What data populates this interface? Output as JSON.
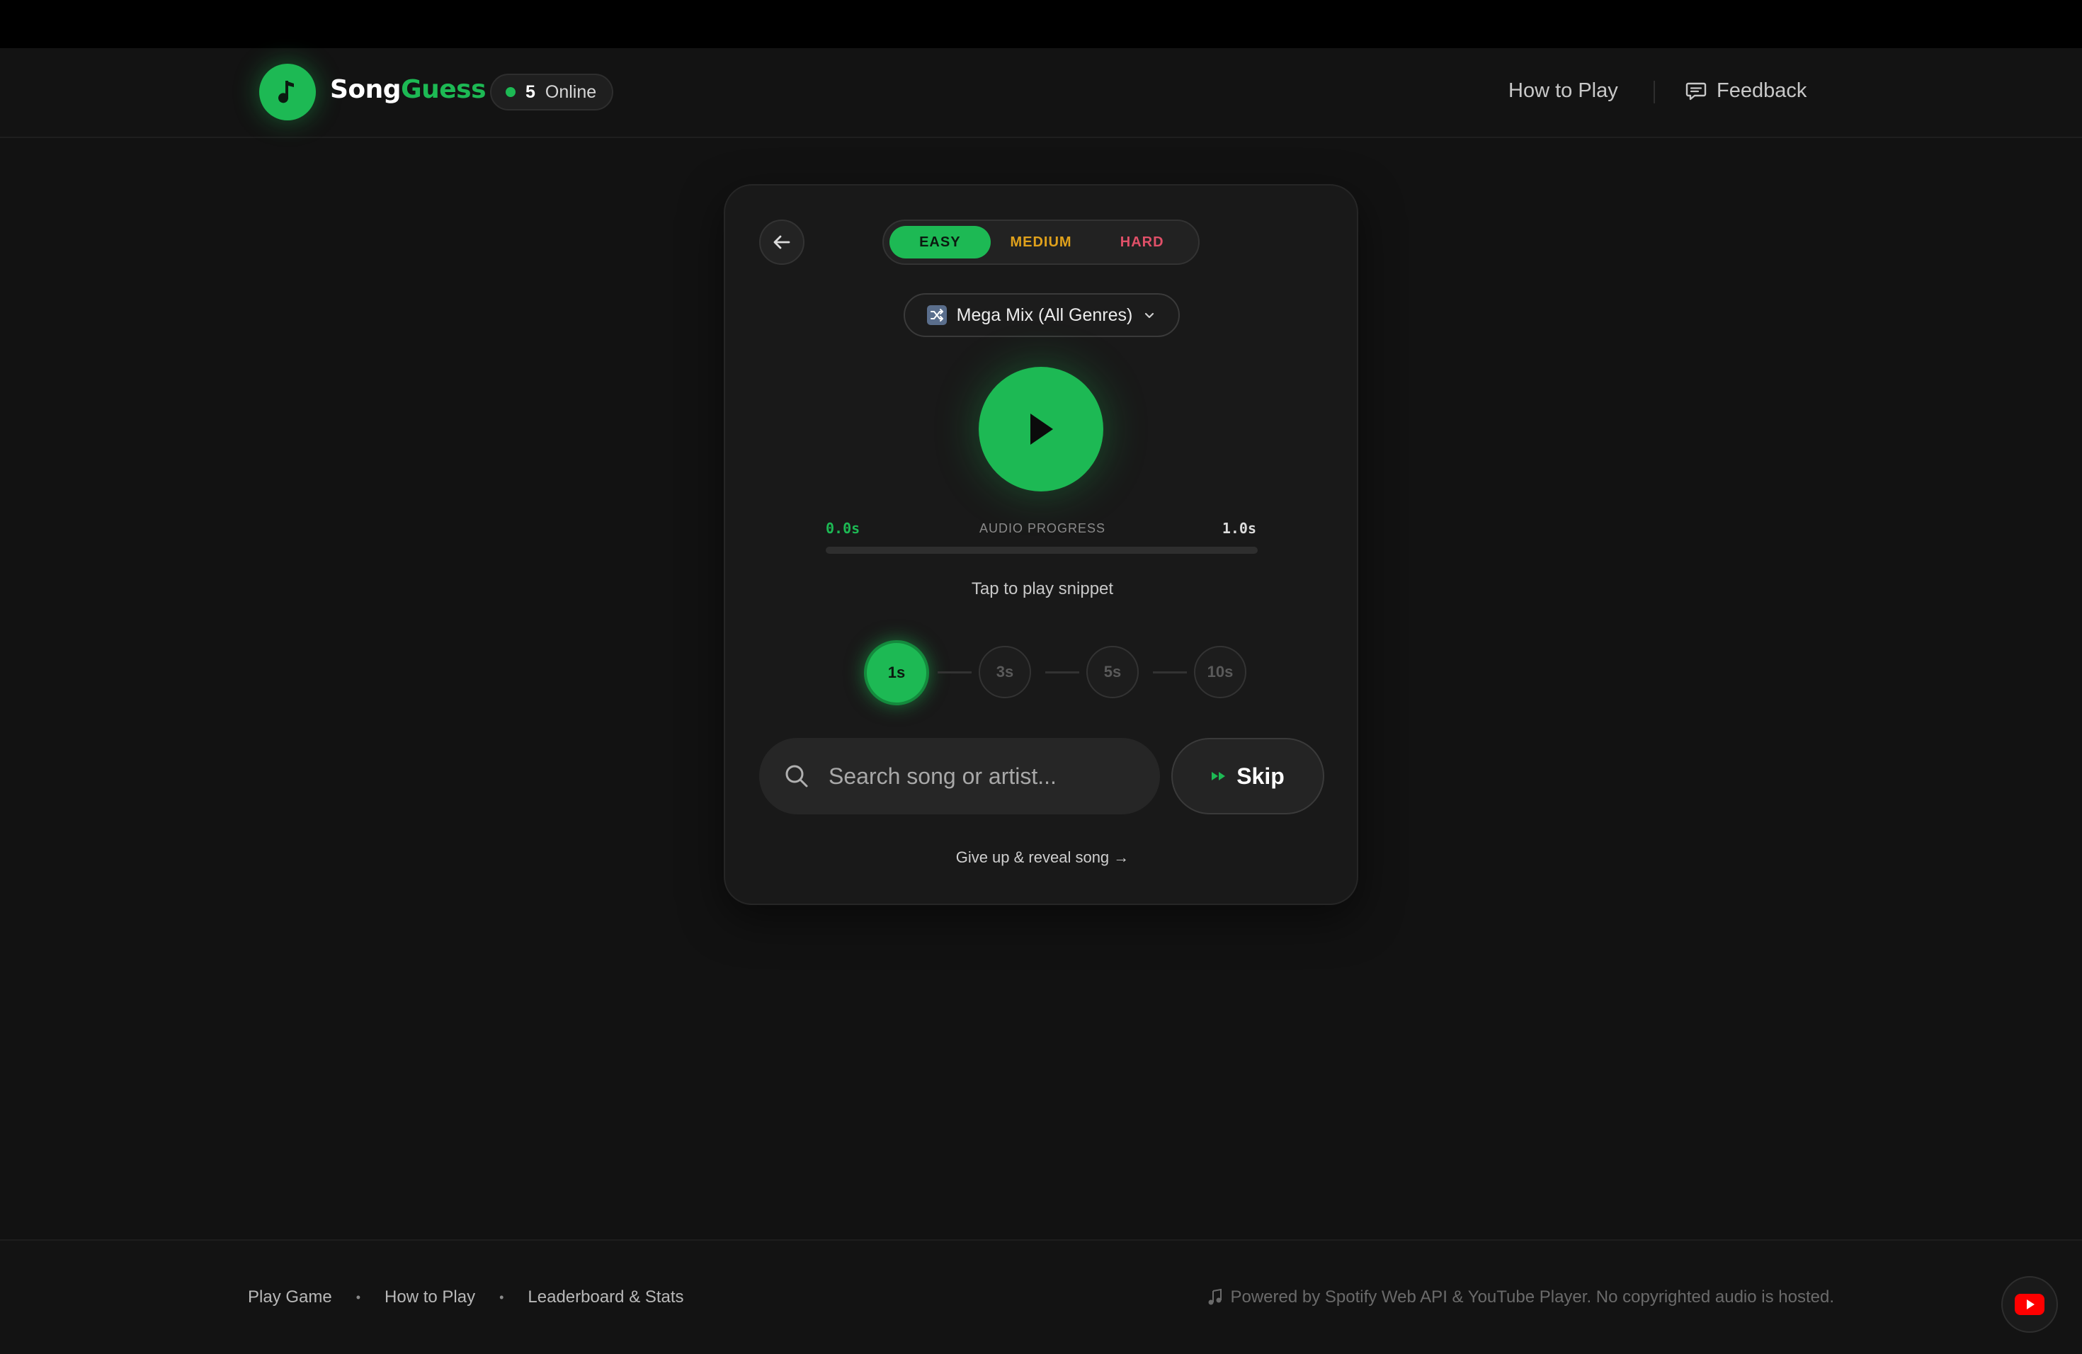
{
  "header": {
    "brand_part1": "Song",
    "brand_part2": "Guess",
    "online_count": "5",
    "online_label": "Online",
    "nav_how_to_play": "How to Play",
    "nav_feedback": "Feedback"
  },
  "game": {
    "difficulty": {
      "easy": "EASY",
      "medium": "MEDIUM",
      "hard": "HARD",
      "selected": "EASY"
    },
    "genre": {
      "selected": "Mega Mix (All Genres)",
      "icon": "shuffle-icon"
    },
    "audio": {
      "current_time": "0.0s",
      "progress_label": "AUDIO PROGRESS",
      "max_time": "1.0s",
      "progress_fraction": 0,
      "hint": "Tap to play snippet"
    },
    "steps": [
      "1s",
      "3s",
      "5s",
      "10s"
    ],
    "active_step": "1s",
    "search": {
      "placeholder": "Search song or artist..."
    },
    "skip_label": "Skip",
    "give_up": "Give up & reveal song →"
  },
  "footer": {
    "links": [
      "Play Game",
      "How to Play",
      "Leaderboard & Stats"
    ],
    "powered_by": "Powered by Spotify Web API & YouTube Player. No copyrighted audio is hosted."
  },
  "colors": {
    "accent": "#1db954",
    "medium": "#e0a11b",
    "hard": "#e05068",
    "background": "#121212"
  }
}
